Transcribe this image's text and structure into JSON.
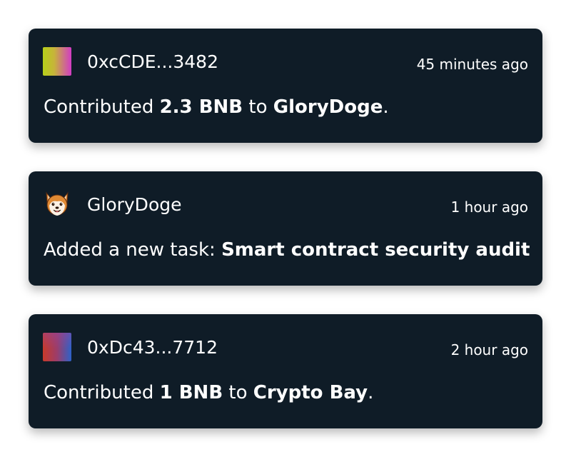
{
  "feed": {
    "items": [
      {
        "user": "0xcCDE...3482",
        "time": "45 minutes ago",
        "avatar_icon": "gradient-identicon",
        "message": {
          "prefix": "Contributed ",
          "amount": "2.3 BNB",
          "connector": " to ",
          "target": "GloryDoge",
          "suffix": "."
        }
      },
      {
        "user": "GloryDoge",
        "time": "1 hour ago",
        "avatar_icon": "shiba-dog-icon",
        "message": {
          "prefix": "Added a new task: ",
          "task": "Smart contract security audit"
        }
      },
      {
        "user": "0xDc43...7712",
        "time": "2 hour ago",
        "avatar_icon": "gradient-identicon",
        "message": {
          "prefix": "Contributed ",
          "amount": "1 BNB",
          "connector": " to ",
          "target": "Crypto Bay",
          "suffix": "."
        }
      }
    ]
  },
  "colors": {
    "card_background": "#0f1c27",
    "text": "#ffffff",
    "page_background": "#ffffff"
  }
}
